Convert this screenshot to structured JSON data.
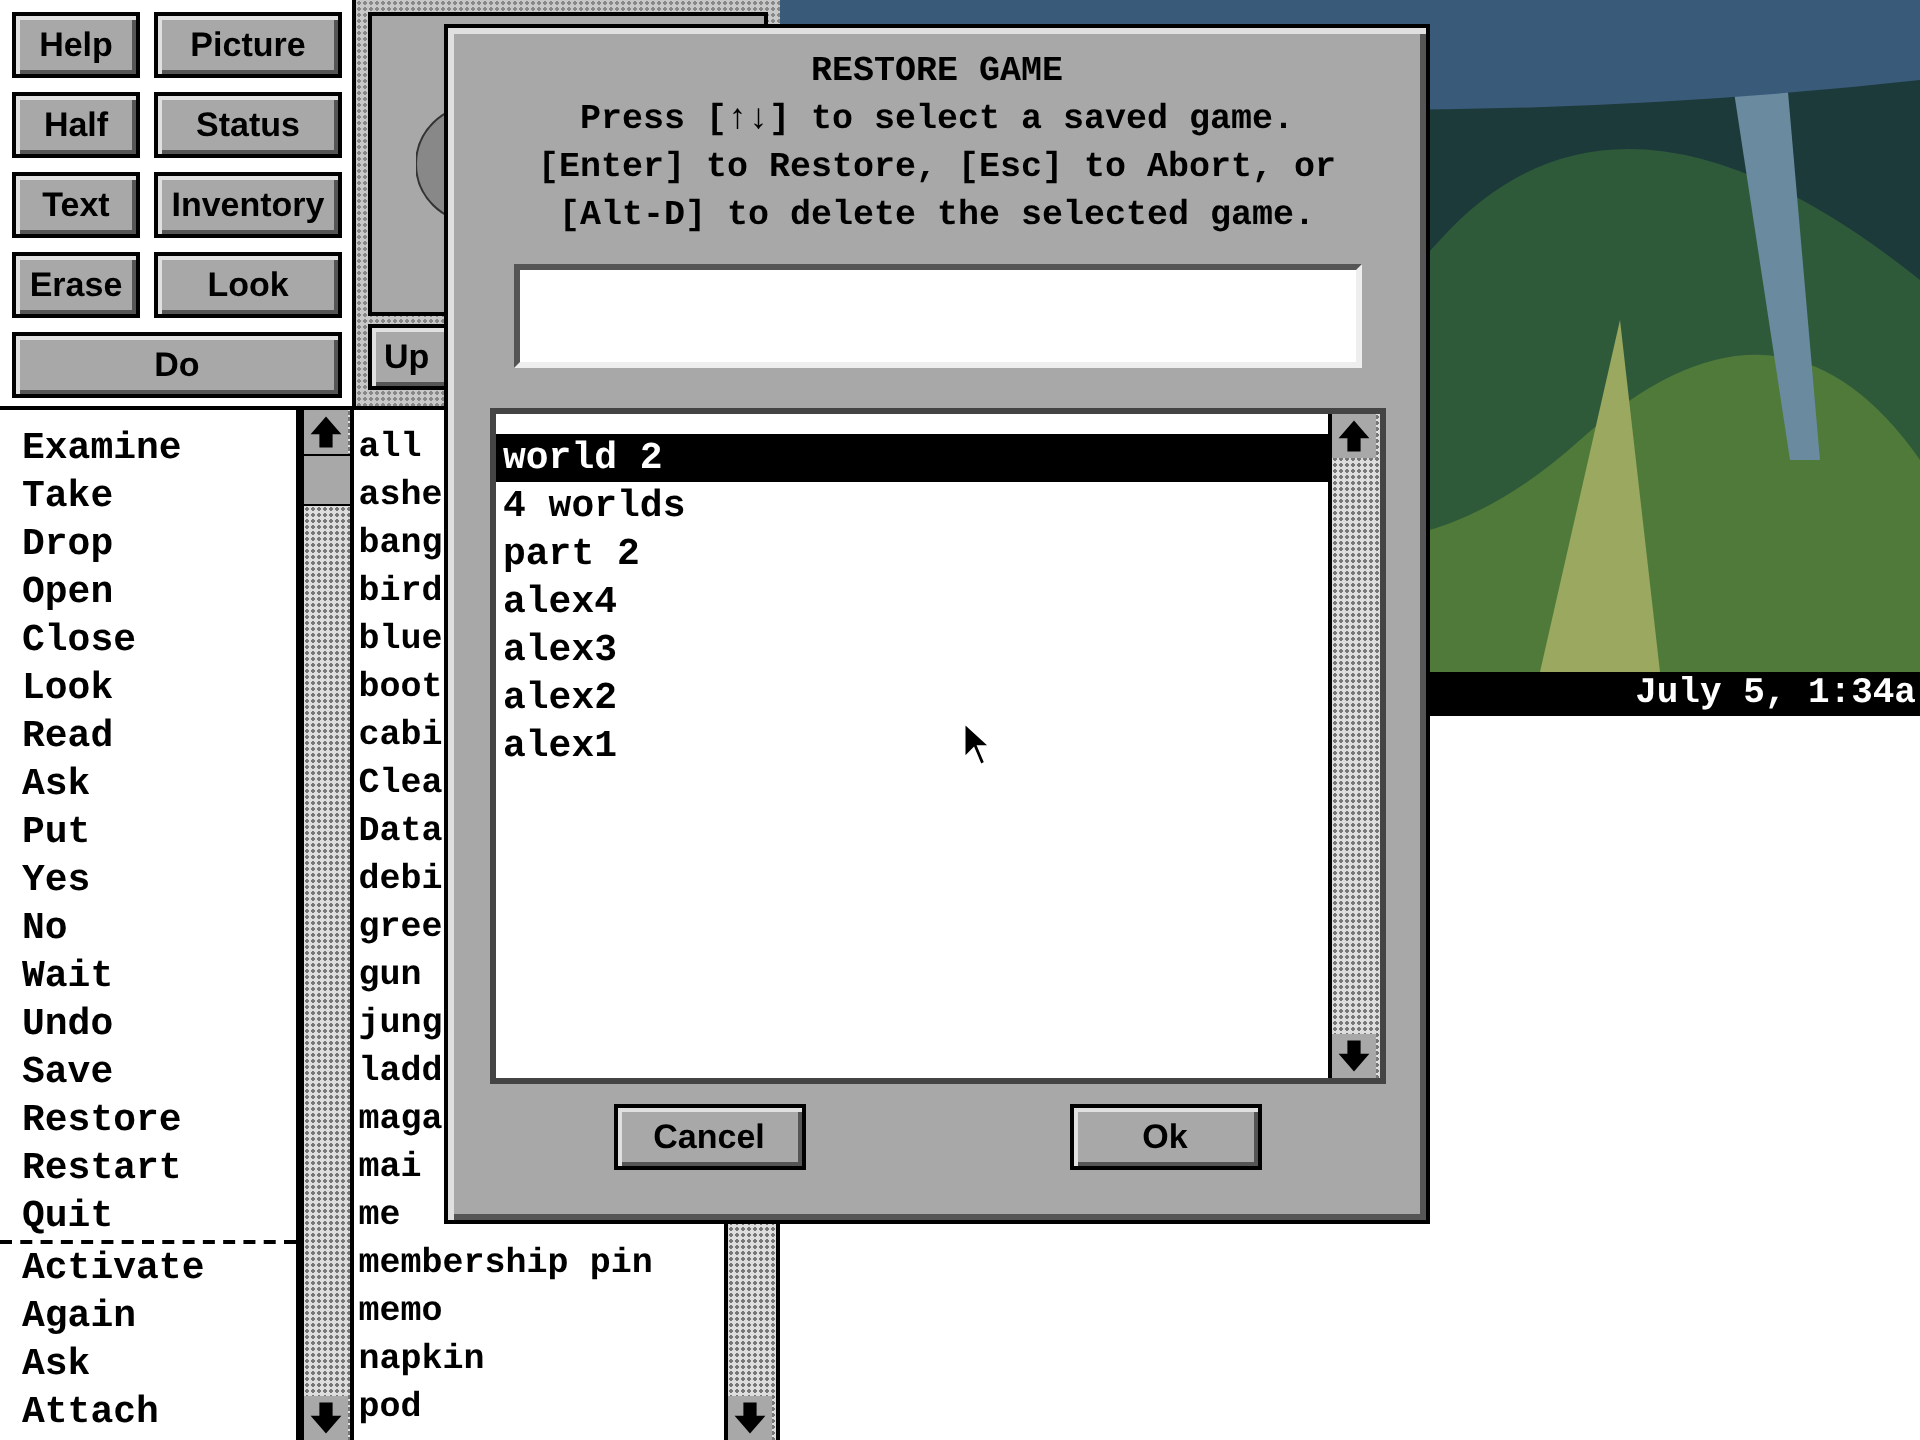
{
  "command_buttons": [
    {
      "label": "Help"
    },
    {
      "label": "Picture"
    },
    {
      "label": "Half"
    },
    {
      "label": "Status"
    },
    {
      "label": "Text"
    },
    {
      "label": "Inventory"
    },
    {
      "label": "Erase"
    },
    {
      "label": "Look"
    }
  ],
  "do_button": {
    "label": "Do"
  },
  "compass": {
    "up_button": {
      "label": "Up"
    }
  },
  "verbs": {
    "primary": [
      "Examine",
      "Take",
      "Drop",
      "Open",
      "Close",
      "Look",
      "Read",
      "Ask",
      "Put",
      "Yes",
      "No",
      "Wait",
      "Undo",
      "Save",
      "Restore",
      "Restart",
      "Quit"
    ],
    "more": [
      "Activate",
      "Again",
      "Ask",
      "Attach"
    ]
  },
  "nouns": [
    "all",
    "ashe",
    "bang",
    "bird",
    "blue",
    "boot",
    "cabi",
    "Clea",
    "Data",
    "debi",
    "gree",
    "gun",
    "jung",
    "ladd",
    "maga",
    "mai",
    "me",
    "membership pin",
    "memo",
    "napkin",
    "pod"
  ],
  "status_bar": {
    "datetime": "July 5, 1:34a"
  },
  "dialog": {
    "title": "RESTORE GAME",
    "instructions": [
      "Press [↑↓] to select a saved game.",
      "[Enter] to Restore, [Esc] to Abort, or",
      "[Alt-D] to delete the selected game."
    ],
    "saved_games": [
      {
        "name": "world 2",
        "selected": true
      },
      {
        "name": "4 worlds",
        "selected": false
      },
      {
        "name": "part 2",
        "selected": false
      },
      {
        "name": "alex4",
        "selected": false
      },
      {
        "name": "alex3",
        "selected": false
      },
      {
        "name": "alex2",
        "selected": false
      },
      {
        "name": "alex1",
        "selected": false
      }
    ],
    "buttons": [
      {
        "label": "Cancel"
      },
      {
        "label": "Ok"
      }
    ]
  }
}
